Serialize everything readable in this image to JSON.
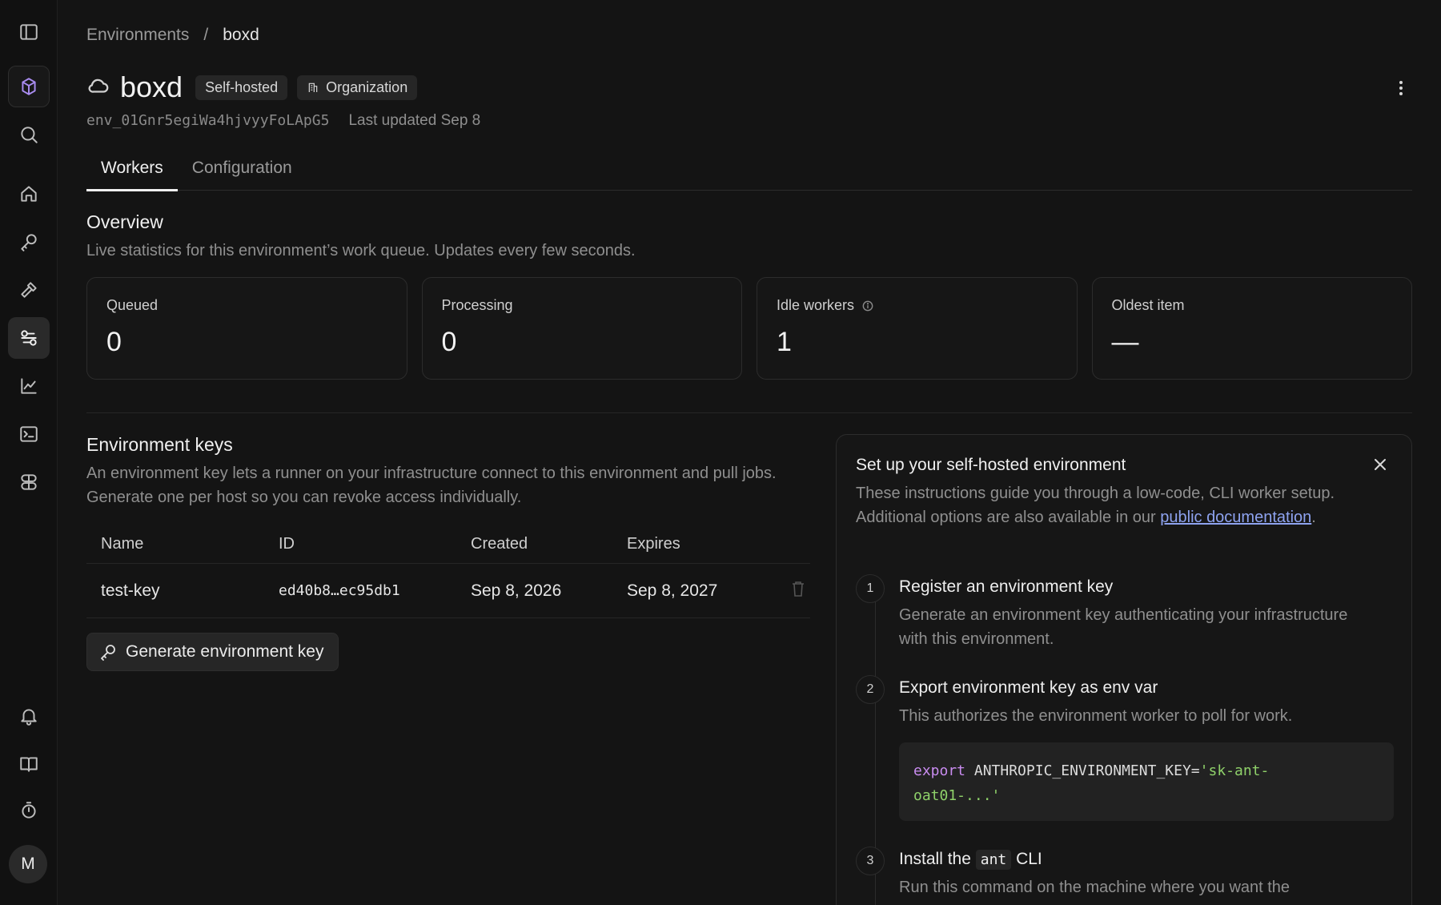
{
  "breadcrumb": {
    "root": "Environments",
    "separator": "/",
    "current": "boxd"
  },
  "header": {
    "title": "boxd",
    "badges": [
      "Self-hosted",
      "Organization"
    ],
    "env_id": "env_01Gnr5egiWa4hjvyyFoLApG5",
    "last_updated": "Last updated Sep 8"
  },
  "tabs": [
    {
      "label": "Workers",
      "active": true
    },
    {
      "label": "Configuration",
      "active": false
    }
  ],
  "overview": {
    "title": "Overview",
    "description": "Live statistics for this environment’s work queue. Updates every few seconds.",
    "stats": [
      {
        "label": "Queued",
        "value": "0"
      },
      {
        "label": "Processing",
        "value": "0"
      },
      {
        "label": "Idle workers",
        "value": "1"
      },
      {
        "label": "Oldest item",
        "value": "—"
      }
    ]
  },
  "keys": {
    "title": "Environment keys",
    "description": "An environment key lets a runner on your infrastructure connect to this environment and pull jobs. Generate one per host so you can revoke access individually.",
    "columns": [
      "Name",
      "ID",
      "Created",
      "Expires"
    ],
    "rows": [
      {
        "name": "test-key",
        "id": "ed40b8…ec95db1",
        "created": "Sep 8, 2026",
        "expires": "Sep 8, 2027"
      }
    ],
    "generate_label": "Generate environment key"
  },
  "setup": {
    "title": "Set up your self-hosted environment",
    "desc_text": "These instructions guide you through a low-code, CLI worker setup. Additional options are also available in our ",
    "desc_link": "public documentation",
    "desc_end": ".",
    "steps": [
      {
        "num": "1",
        "title": "Register an environment key",
        "desc": "Generate an environment key authenticating your infrastructure with this environment."
      },
      {
        "num": "2",
        "title": "Export environment key as env var",
        "desc": "This authorizes the environment worker to poll for work.",
        "code_kw": "export",
        "code_var": " ANTHROPIC_ENVIRONMENT_KEY=",
        "code_str1": "'sk-ant-",
        "code_str2": "oat01-...'"
      },
      {
        "num": "3",
        "title_pre": "Install the ",
        "title_code": "ant",
        "title_post": " CLI",
        "desc": "Run this command on the machine where you want the"
      }
    ]
  },
  "sidebar": {
    "avatar_initial": "M"
  },
  "colors": {
    "accent_purple": "#a98cf0",
    "link": "#8ea3f0",
    "code_string": "#8fd16a",
    "code_keyword": "#c98cf0"
  }
}
